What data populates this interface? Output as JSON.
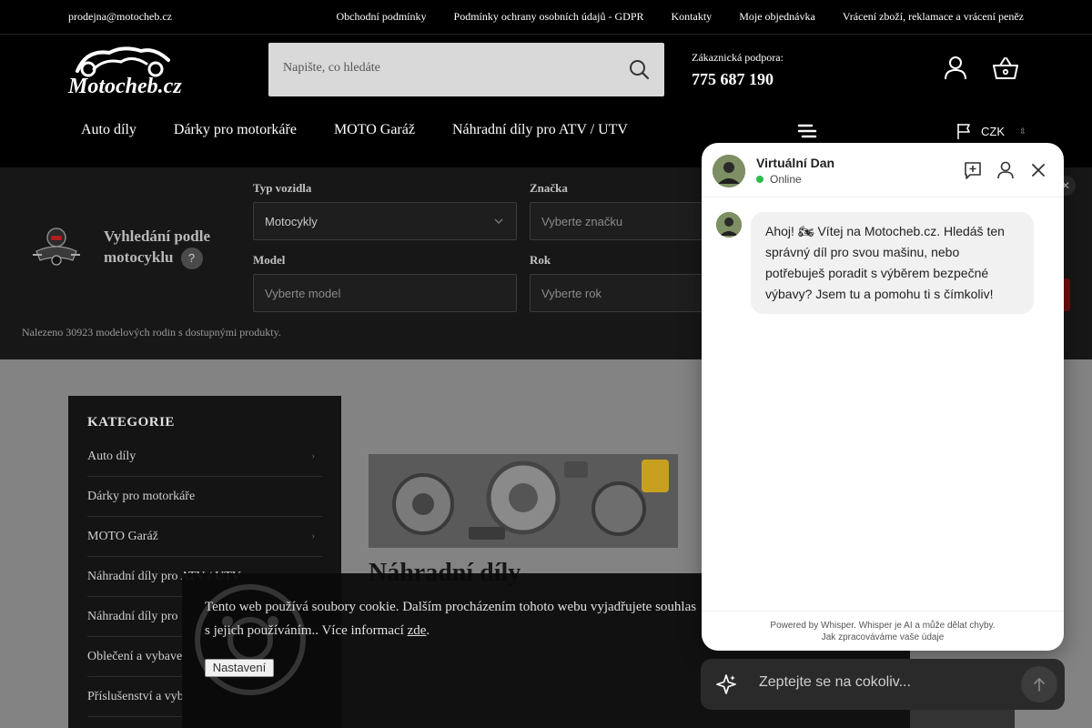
{
  "topbar": {
    "email": "prodejna@motocheb.cz",
    "links": [
      "Obchodní podmínky",
      "Podmínky ochrany osobních údajů - GDPR",
      "Kontakty",
      "Moje objednávka",
      "Vrácení zboží, reklamace a vrácení peněz"
    ]
  },
  "header": {
    "logo_text": "Motocheb.cz",
    "search_placeholder": "Napište, co hledáte",
    "support_label": "Zákaznická podpora:",
    "support_phone": "775 687 190",
    "nav": [
      "Auto díly",
      "Dárky pro motorkáře",
      "MOTO Garáž",
      "Náhradní díly pro ATV / UTV"
    ],
    "currency": "CZK",
    "currency_caret": "⇳"
  },
  "finder": {
    "title": "Vyhledání podle motocyklu",
    "help": "?",
    "fields": {
      "vehicle_type": {
        "label": "Typ vozidla",
        "value": "Motocykly"
      },
      "brand": {
        "label": "Značka",
        "placeholder": "Vyberte značku"
      },
      "model": {
        "label": "Model",
        "placeholder": "Vyberte model"
      },
      "year": {
        "label": "Rok",
        "placeholder": "Vyberte rok"
      }
    },
    "count_text": "Nalezeno 30923 modelových rodin s dostupnými produkty.",
    "close": "✕"
  },
  "sidebar": {
    "title": "KATEGORIE",
    "items": [
      {
        "label": "Auto díly",
        "arrow": "›"
      },
      {
        "label": "Dárky pro motorkáře",
        "arrow": ""
      },
      {
        "label": "MOTO Garáž",
        "arrow": "›"
      },
      {
        "label": "Náhradní díly pro ATV / UTV",
        "arrow": ""
      },
      {
        "label": "Náhradní díly pro",
        "arrow": ""
      },
      {
        "label": "Oblečení a vybave",
        "arrow": ""
      },
      {
        "label": "Příslušenství a vyb",
        "arrow": ""
      }
    ]
  },
  "main": {
    "heading": "Náhradní díly"
  },
  "cookie": {
    "text_main": "Tento web používá soubory cookie. Dalším procházením tohoto webu vyjadřujete souhlas s jejich používáním.. Více informací ",
    "link": "zde",
    "text_end": ".",
    "button": "Nastavení"
  },
  "chat": {
    "agent_name": "Virtuální Dan",
    "status": "Online",
    "message": "Ahoj! 🏍 Vítej na Motocheb.cz. Hledáš ten správný díl pro svou mašinu, nebo potřebuješ poradit s výběrem bezpečné výbavy? Jsem tu a pomohu ti s čímkoliv!",
    "footer_line1": "Powered by Whisper. Whisper je AI a může dělat chyby.",
    "footer_line2": "Jak zpracováváme vaše údaje",
    "input_placeholder": "Zeptejte se na cokoliv..."
  },
  "colors": {
    "header_bg": "#000000",
    "finder_bg": "#171717",
    "online": "#2dbb4e",
    "chat_bg": "#ffffff"
  }
}
